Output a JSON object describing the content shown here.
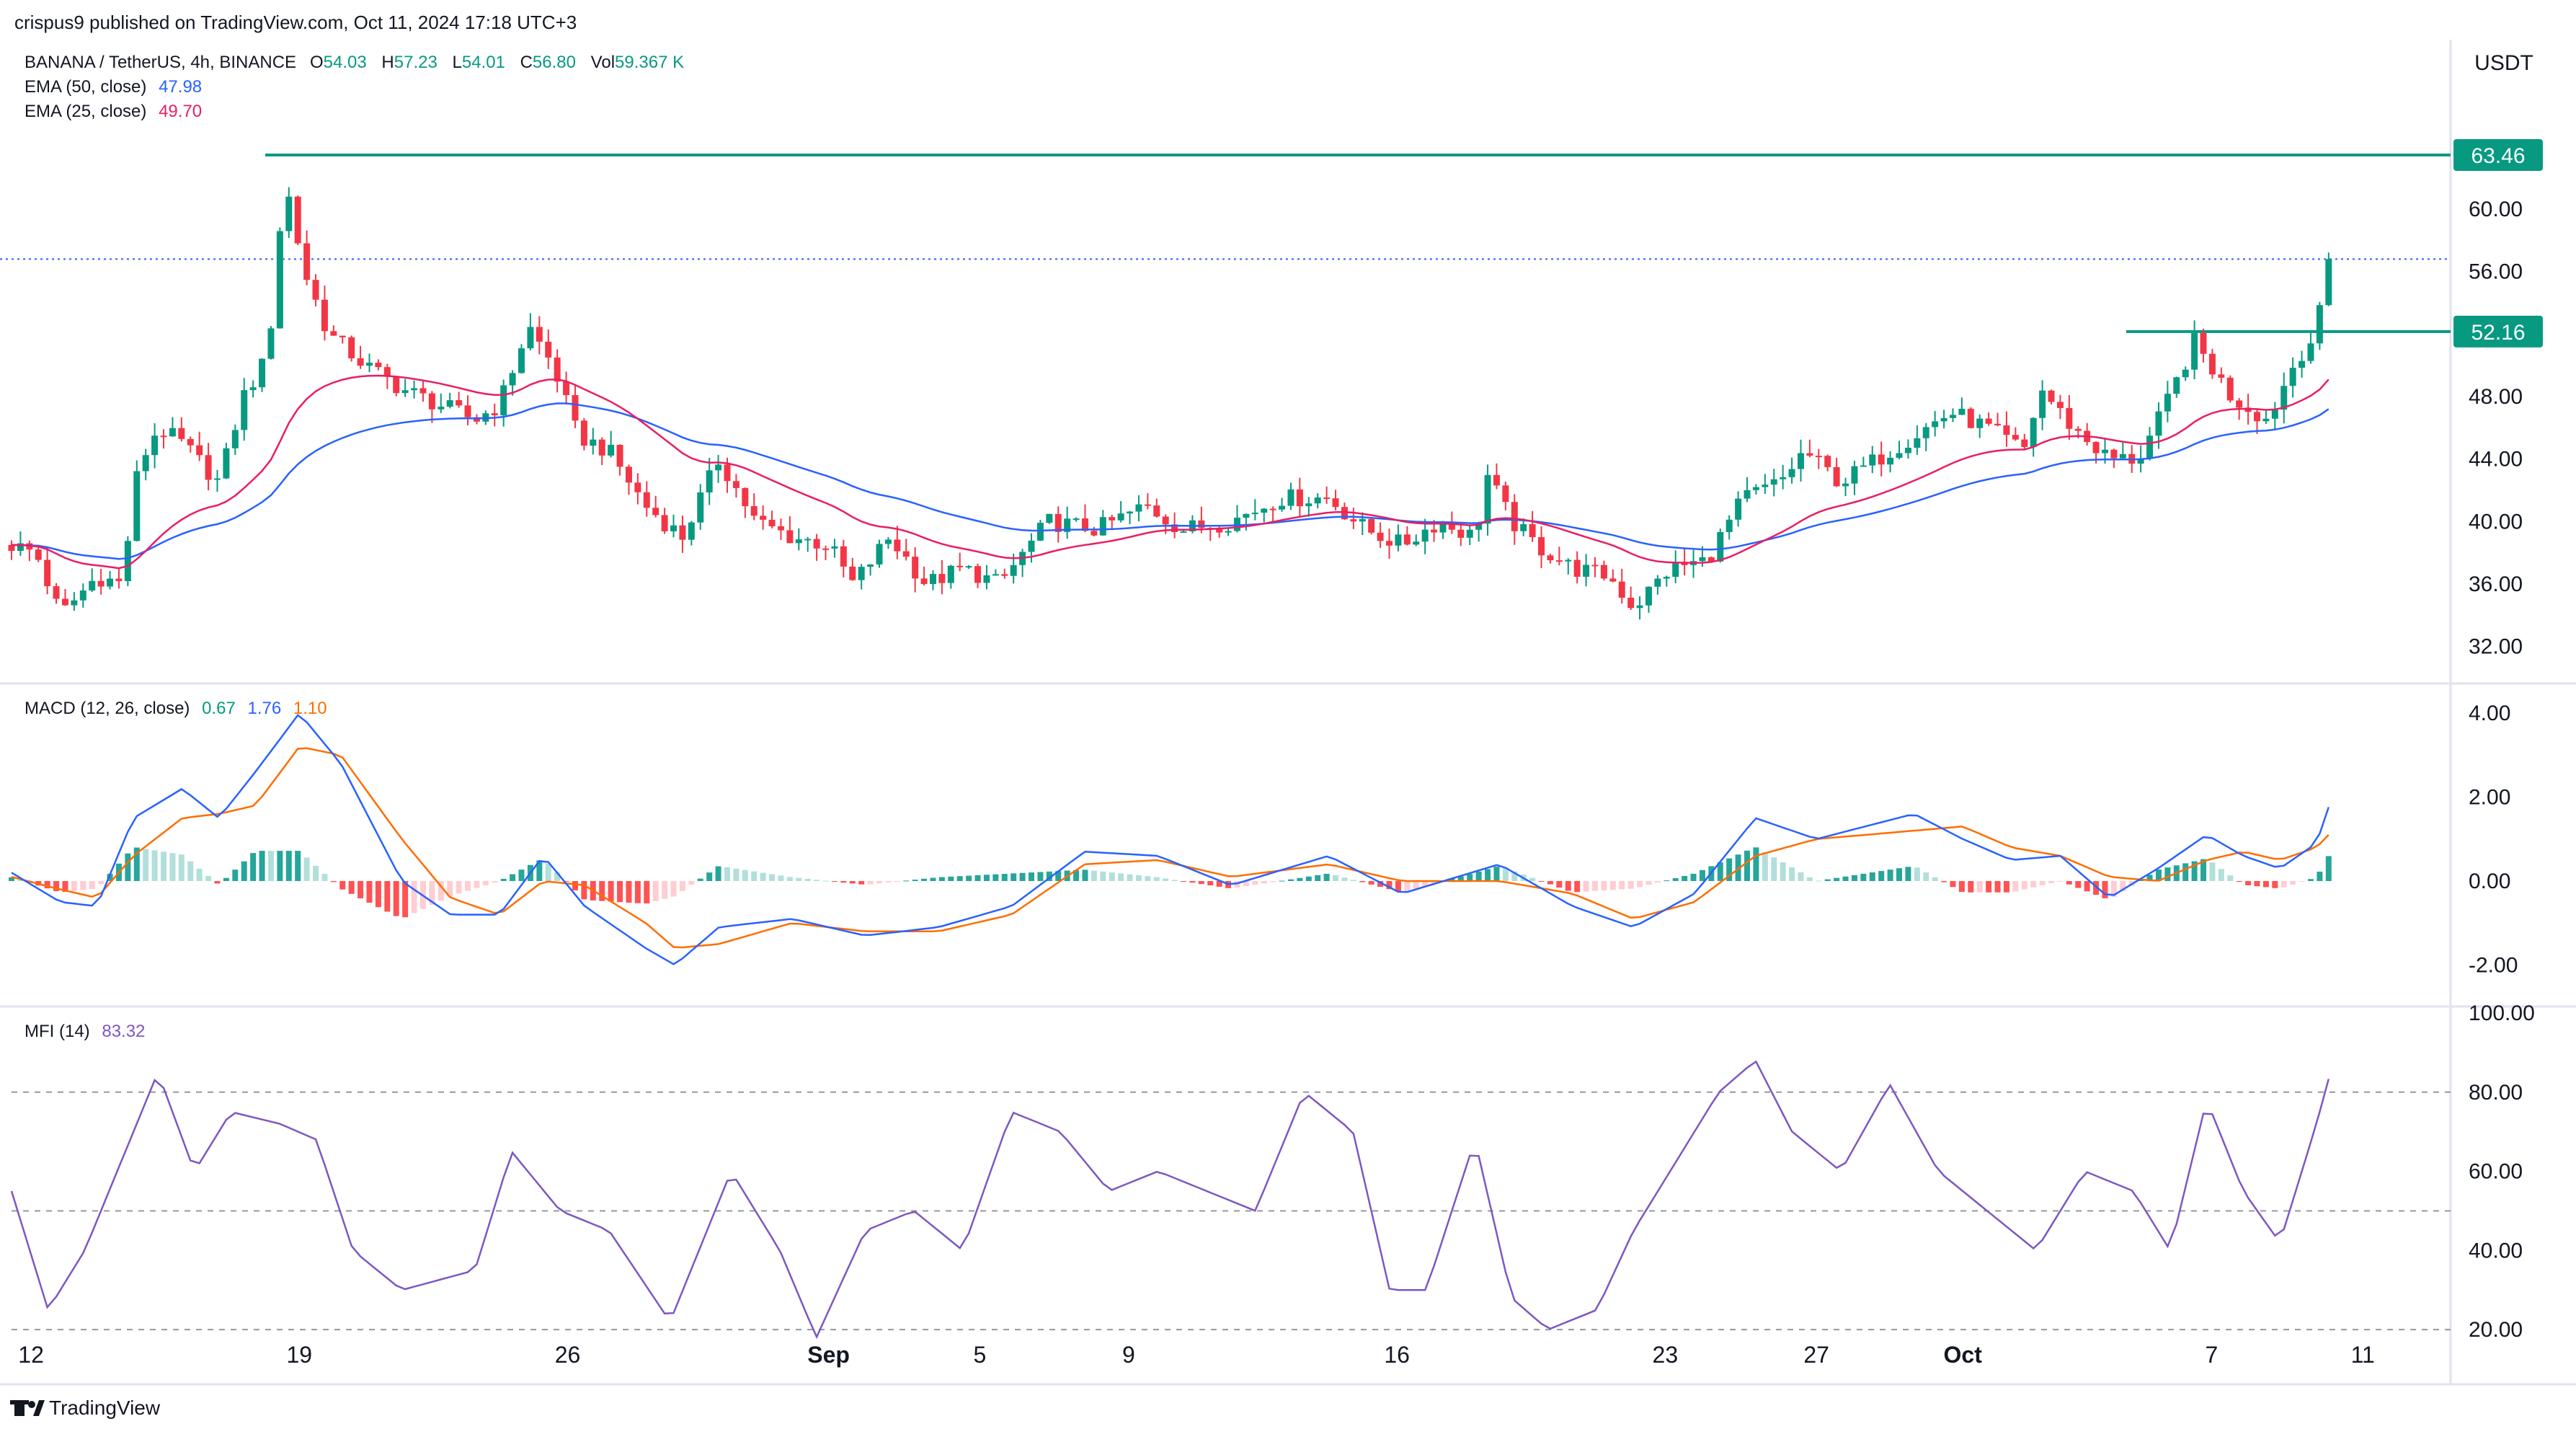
{
  "header": {
    "published_by": "crispus9 published on TradingView.com, Oct 11, 2024 17:18 UTC+3",
    "symbol": "BANANA / TetherUS, 4h, BINANCE",
    "ohlc": [
      {
        "label": "O",
        "value": "54.03"
      },
      {
        "label": "H",
        "value": "57.23"
      },
      {
        "label": "L",
        "value": "54.01"
      },
      {
        "label": "C",
        "value": "56.80"
      },
      {
        "label": "Vol",
        "value": "59.367 K"
      }
    ],
    "ema50_label": "EMA (50, close)",
    "ema50_value": "47.98",
    "ema25_label": "EMA (25, close)",
    "ema25_value": "49.70",
    "currency": "USDT"
  },
  "macd_header": {
    "label": "MACD (12, 26, close)",
    "hist": "0.67",
    "macd": "1.76",
    "signal": "1.10"
  },
  "mfi_header": {
    "label": "MFI (14)",
    "value": "83.32"
  },
  "footer": {
    "brand": "TradingView"
  },
  "colors": {
    "up": "#089981",
    "down": "#f23645",
    "ema50": "#2962ff",
    "ema25": "#e91e63",
    "macd": "#2962ff",
    "signal": "#ff6d00",
    "mfi": "#7e57c2",
    "level": "#089981",
    "hist_up_strong": "#26a69a",
    "hist_up_weak": "#b2dfdb",
    "hist_down_strong": "#ff5252",
    "hist_down_weak": "#ffcdd2"
  },
  "chart_data": {
    "type": "candlestick",
    "x_ticks": [
      "12",
      "19",
      "26",
      "Sep",
      "5",
      "9",
      "16",
      "23",
      "27",
      "Oct",
      "7",
      "11"
    ],
    "price_axis": {
      "ticks": [
        "60.00",
        "56.00",
        "52.00",
        "48.00",
        "44.00",
        "40.00",
        "36.00",
        "32.00"
      ],
      "ylim": [
        30,
        66
      ]
    },
    "price_labels": {
      "high_line": "63.46",
      "resistance_line": "52.16"
    },
    "last_price": 56.8,
    "levels": {
      "high": 63.46,
      "resistance": 52.16
    },
    "anchors": [
      {
        "x": 0,
        "close": 38.5
      },
      {
        "x": 0.01,
        "close": 38.0
      },
      {
        "x": 0.02,
        "close": 34.0
      },
      {
        "x": 0.035,
        "close": 36.5
      },
      {
        "x": 0.045,
        "close": 36.0
      },
      {
        "x": 0.052,
        "close": 43.5
      },
      {
        "x": 0.06,
        "close": 46.0
      },
      {
        "x": 0.07,
        "close": 45.0
      },
      {
        "x": 0.085,
        "close": 42.5
      },
      {
        "x": 0.095,
        "close": 48.0
      },
      {
        "x": 0.105,
        "close": 50.5
      },
      {
        "x": 0.112,
        "close": 62.0
      },
      {
        "x": 0.12,
        "close": 56.0
      },
      {
        "x": 0.13,
        "close": 52.0
      },
      {
        "x": 0.145,
        "close": 50.0
      },
      {
        "x": 0.16,
        "close": 48.5
      },
      {
        "x": 0.175,
        "close": 47.5
      },
      {
        "x": 0.19,
        "close": 46.5
      },
      {
        "x": 0.2,
        "close": 47.5
      },
      {
        "x": 0.212,
        "close": 52.5
      },
      {
        "x": 0.222,
        "close": 50.0
      },
      {
        "x": 0.232,
        "close": 45.5
      },
      {
        "x": 0.245,
        "close": 44.5
      },
      {
        "x": 0.26,
        "close": 41.0
      },
      {
        "x": 0.275,
        "close": 39.0
      },
      {
        "x": 0.29,
        "close": 44.0
      },
      {
        "x": 0.305,
        "close": 40.0
      },
      {
        "x": 0.32,
        "close": 39.0
      },
      {
        "x": 0.335,
        "close": 38.5
      },
      {
        "x": 0.345,
        "close": 36.0
      },
      {
        "x": 0.36,
        "close": 39.0
      },
      {
        "x": 0.375,
        "close": 36.0
      },
      {
        "x": 0.39,
        "close": 37.0
      },
      {
        "x": 0.405,
        "close": 36.0
      },
      {
        "x": 0.425,
        "close": 40.0
      },
      {
        "x": 0.445,
        "close": 39.5
      },
      {
        "x": 0.465,
        "close": 41.0
      },
      {
        "x": 0.48,
        "close": 39.5
      },
      {
        "x": 0.5,
        "close": 40.0
      },
      {
        "x": 0.52,
        "close": 41.5
      },
      {
        "x": 0.54,
        "close": 41.5
      },
      {
        "x": 0.555,
        "close": 39.5
      },
      {
        "x": 0.57,
        "close": 38.5
      },
      {
        "x": 0.585,
        "close": 40.0
      },
      {
        "x": 0.6,
        "close": 39.0
      },
      {
        "x": 0.605,
        "close": 43.0
      },
      {
        "x": 0.615,
        "close": 40.0
      },
      {
        "x": 0.625,
        "close": 38.5
      },
      {
        "x": 0.64,
        "close": 37.0
      },
      {
        "x": 0.655,
        "close": 36.5
      },
      {
        "x": 0.665,
        "close": 34.5
      },
      {
        "x": 0.68,
        "close": 37.0
      },
      {
        "x": 0.695,
        "close": 37.5
      },
      {
        "x": 0.71,
        "close": 41.5
      },
      {
        "x": 0.725,
        "close": 42.5
      },
      {
        "x": 0.735,
        "close": 44.5
      },
      {
        "x": 0.75,
        "close": 42.5
      },
      {
        "x": 0.765,
        "close": 44.0
      },
      {
        "x": 0.78,
        "close": 45.5
      },
      {
        "x": 0.795,
        "close": 47.0
      },
      {
        "x": 0.81,
        "close": 46.0
      },
      {
        "x": 0.825,
        "close": 44.5
      },
      {
        "x": 0.832,
        "close": 48.5
      },
      {
        "x": 0.845,
        "close": 46.0
      },
      {
        "x": 0.86,
        "close": 44.0
      },
      {
        "x": 0.872,
        "close": 44.0
      },
      {
        "x": 0.882,
        "close": 47.0
      },
      {
        "x": 0.895,
        "close": 51.5
      },
      {
        "x": 0.91,
        "close": 48.0
      },
      {
        "x": 0.925,
        "close": 46.5
      },
      {
        "x": 0.937,
        "close": 50.5
      },
      {
        "x": 0.945,
        "close": 52.0
      },
      {
        "x": 0.95,
        "close": 56.8
      }
    ],
    "macd_axis": {
      "ticks": [
        "4.00",
        "2.00",
        "0.00",
        "-2.00"
      ],
      "ylim": [
        -2.8,
        4.5
      ]
    },
    "macd_anchors": [
      {
        "x": 0,
        "macd": 0.2,
        "signal": 0.1
      },
      {
        "x": 0.02,
        "macd": -0.5,
        "signal": -0.2
      },
      {
        "x": 0.035,
        "macd": -0.6,
        "signal": -0.4
      },
      {
        "x": 0.05,
        "macd": 1.5,
        "signal": 0.6
      },
      {
        "x": 0.07,
        "macd": 2.2,
        "signal": 1.5
      },
      {
        "x": 0.085,
        "macd": 1.5,
        "signal": 1.6
      },
      {
        "x": 0.1,
        "macd": 2.6,
        "signal": 1.8
      },
      {
        "x": 0.118,
        "macd": 4.0,
        "signal": 3.2
      },
      {
        "x": 0.135,
        "macd": 2.8,
        "signal": 3.0
      },
      {
        "x": 0.16,
        "macd": 0.0,
        "signal": 1.0
      },
      {
        "x": 0.18,
        "macd": -0.8,
        "signal": -0.4
      },
      {
        "x": 0.2,
        "macd": -0.8,
        "signal": -0.8
      },
      {
        "x": 0.218,
        "macd": 0.6,
        "signal": 0.0
      },
      {
        "x": 0.235,
        "macd": -0.6,
        "signal": -0.1
      },
      {
        "x": 0.26,
        "macd": -1.6,
        "signal": -1.0
      },
      {
        "x": 0.272,
        "macd": -2.0,
        "signal": -1.6
      },
      {
        "x": 0.29,
        "macd": -1.1,
        "signal": -1.5
      },
      {
        "x": 0.32,
        "macd": -0.9,
        "signal": -1.0
      },
      {
        "x": 0.35,
        "macd": -1.3,
        "signal": -1.2
      },
      {
        "x": 0.38,
        "macd": -1.1,
        "signal": -1.2
      },
      {
        "x": 0.41,
        "macd": -0.6,
        "signal": -0.8
      },
      {
        "x": 0.44,
        "macd": 0.7,
        "signal": 0.4
      },
      {
        "x": 0.47,
        "macd": 0.6,
        "signal": 0.5
      },
      {
        "x": 0.5,
        "macd": -0.1,
        "signal": 0.1
      },
      {
        "x": 0.54,
        "macd": 0.6,
        "signal": 0.4
      },
      {
        "x": 0.57,
        "macd": -0.3,
        "signal": 0.0
      },
      {
        "x": 0.61,
        "macd": 0.4,
        "signal": 0.0
      },
      {
        "x": 0.64,
        "macd": -0.6,
        "signal": -0.3
      },
      {
        "x": 0.665,
        "macd": -1.1,
        "signal": -0.9
      },
      {
        "x": 0.69,
        "macd": -0.3,
        "signal": -0.5
      },
      {
        "x": 0.715,
        "macd": 1.5,
        "signal": 0.6
      },
      {
        "x": 0.74,
        "macd": 1.0,
        "signal": 1.0
      },
      {
        "x": 0.76,
        "macd": 1.3,
        "signal": 1.1
      },
      {
        "x": 0.78,
        "macd": 1.6,
        "signal": 1.2
      },
      {
        "x": 0.8,
        "macd": 1.0,
        "signal": 1.3
      },
      {
        "x": 0.82,
        "macd": 0.5,
        "signal": 0.8
      },
      {
        "x": 0.84,
        "macd": 0.6,
        "signal": 0.6
      },
      {
        "x": 0.86,
        "macd": -0.4,
        "signal": 0.1
      },
      {
        "x": 0.88,
        "macd": 0.3,
        "signal": 0.0
      },
      {
        "x": 0.9,
        "macd": 1.1,
        "signal": 0.5
      },
      {
        "x": 0.915,
        "macd": 0.6,
        "signal": 0.7
      },
      {
        "x": 0.93,
        "macd": 0.3,
        "signal": 0.5
      },
      {
        "x": 0.945,
        "macd": 0.9,
        "signal": 0.8
      },
      {
        "x": 0.95,
        "macd": 1.76,
        "signal": 1.1
      }
    ],
    "mfi_axis": {
      "ticks": [
        "100.00",
        "80.00",
        "60.00",
        "40.00",
        "20.00"
      ],
      "ylim": [
        8,
        100
      ],
      "bands": [
        80,
        50,
        20
      ]
    },
    "mfi_anchors": [
      {
        "x": 0,
        "mfi": 55
      },
      {
        "x": 0.015,
        "mfi": 25
      },
      {
        "x": 0.03,
        "mfi": 40
      },
      {
        "x": 0.05,
        "mfi": 70
      },
      {
        "x": 0.06,
        "mfi": 85
      },
      {
        "x": 0.075,
        "mfi": 60
      },
      {
        "x": 0.09,
        "mfi": 75
      },
      {
        "x": 0.11,
        "mfi": 72
      },
      {
        "x": 0.125,
        "mfi": 68
      },
      {
        "x": 0.14,
        "mfi": 40
      },
      {
        "x": 0.16,
        "mfi": 30
      },
      {
        "x": 0.19,
        "mfi": 35
      },
      {
        "x": 0.205,
        "mfi": 65
      },
      {
        "x": 0.225,
        "mfi": 50
      },
      {
        "x": 0.245,
        "mfi": 45
      },
      {
        "x": 0.27,
        "mfi": 22
      },
      {
        "x": 0.295,
        "mfi": 60
      },
      {
        "x": 0.315,
        "mfi": 40
      },
      {
        "x": 0.33,
        "mfi": 18
      },
      {
        "x": 0.35,
        "mfi": 45
      },
      {
        "x": 0.37,
        "mfi": 50
      },
      {
        "x": 0.39,
        "mfi": 40
      },
      {
        "x": 0.41,
        "mfi": 75
      },
      {
        "x": 0.43,
        "mfi": 70
      },
      {
        "x": 0.45,
        "mfi": 55
      },
      {
        "x": 0.47,
        "mfi": 60
      },
      {
        "x": 0.49,
        "mfi": 55
      },
      {
        "x": 0.51,
        "mfi": 50
      },
      {
        "x": 0.53,
        "mfi": 80
      },
      {
        "x": 0.55,
        "mfi": 70
      },
      {
        "x": 0.565,
        "mfi": 30
      },
      {
        "x": 0.58,
        "mfi": 30
      },
      {
        "x": 0.6,
        "mfi": 68
      },
      {
        "x": 0.615,
        "mfi": 28
      },
      {
        "x": 0.63,
        "mfi": 20
      },
      {
        "x": 0.65,
        "mfi": 25
      },
      {
        "x": 0.665,
        "mfi": 45
      },
      {
        "x": 0.68,
        "mfi": 60
      },
      {
        "x": 0.7,
        "mfi": 80
      },
      {
        "x": 0.715,
        "mfi": 88
      },
      {
        "x": 0.73,
        "mfi": 70
      },
      {
        "x": 0.75,
        "mfi": 60
      },
      {
        "x": 0.77,
        "mfi": 82
      },
      {
        "x": 0.79,
        "mfi": 60
      },
      {
        "x": 0.81,
        "mfi": 50
      },
      {
        "x": 0.83,
        "mfi": 40
      },
      {
        "x": 0.85,
        "mfi": 60
      },
      {
        "x": 0.87,
        "mfi": 55
      },
      {
        "x": 0.885,
        "mfi": 40
      },
      {
        "x": 0.9,
        "mfi": 78
      },
      {
        "x": 0.915,
        "mfi": 55
      },
      {
        "x": 0.93,
        "mfi": 42
      },
      {
        "x": 0.945,
        "mfi": 72
      },
      {
        "x": 0.95,
        "mfi": 83.32
      }
    ]
  }
}
